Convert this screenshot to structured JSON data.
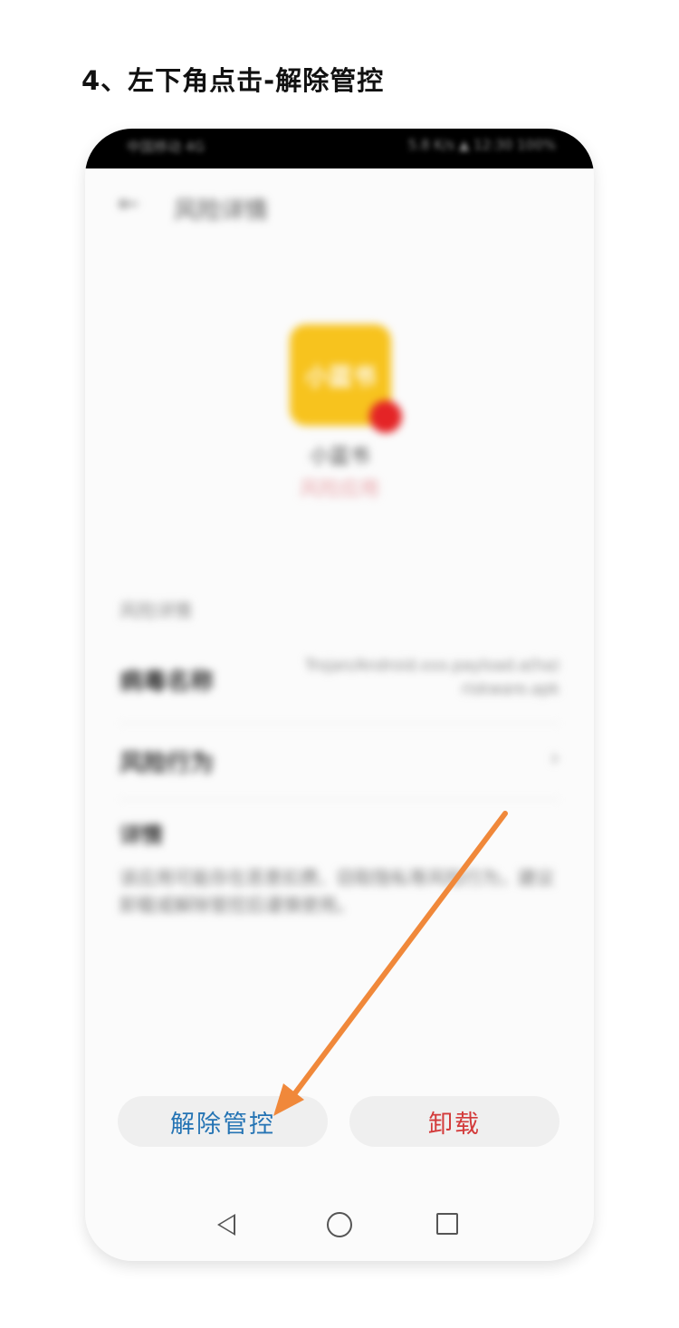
{
  "step": {
    "title": "4、左下角点击-解除管控"
  },
  "status_bar": {
    "left": "中国移动 4G",
    "right": "5.8 K/s ▲ 12:30 100%"
  },
  "header": {
    "back_icon": "back-arrow-icon",
    "title": "风险详情"
  },
  "app": {
    "icon_text": "小蓝书",
    "name": "小蓝书",
    "status": "风险应用"
  },
  "details": {
    "section_label": "风险详情",
    "virus_name_label": "病毒名称",
    "virus_name_value": "Trojan/Android.xxx.payload.a(ha) riskware.apk",
    "risk_behavior_label": "风险行为",
    "description_title": "详情",
    "description_text": "该应用可能存在恶意扣费、窃取隐私等风险行为，建议卸载或解除管控后谨慎使用。"
  },
  "actions": {
    "unlock_label": "解除管控",
    "uninstall_label": "卸载"
  },
  "colors": {
    "unlock": "#2574b4",
    "uninstall": "#d33a3a",
    "app_icon_bg": "#f7c31e",
    "risk_dot": "#e42426",
    "arrow": "#f0883a"
  }
}
